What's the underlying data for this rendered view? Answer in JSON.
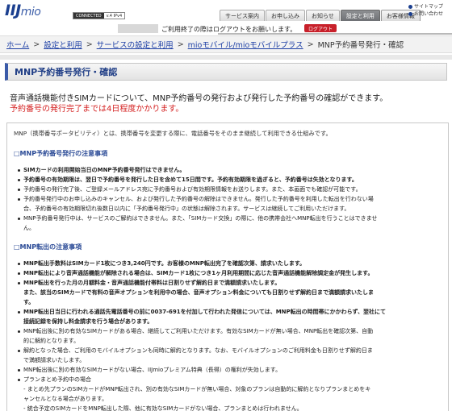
{
  "header": {
    "logo_main": "IIJ",
    "logo_sub": "mio",
    "conn_a": "CONNECTED",
    "conn_b": "v.4 IPv4",
    "tabs": [
      "サービス案内",
      "お申し込み",
      "お知らせ",
      "設定と利用",
      "お客様情報"
    ],
    "util": [
      "サイトマップ",
      "お問い合わせ"
    ]
  },
  "notice": {
    "text": "ご利用終了の際はログアウトをお願いします。",
    "logout": "ログアウト"
  },
  "breadcrumb": {
    "items": [
      "ホーム",
      "設定と利用",
      "サービスの設定と利用",
      "mioモバイル/mioモバイルプラス"
    ],
    "current": "MNP予約番号発行・確認"
  },
  "page": {
    "title": "MNP予約番号発行・確認",
    "lead1": "音声通話機能付きSIMカードについて、MNP予約番号の発行および発行した予約番号の確認ができます。",
    "lead2": "予約番号の発行完了までは4日程度かかります。"
  },
  "content": {
    "intro": "MNP（携帯番号ポータビリティ）とは、携帯番号を変更する際に、電話番号をそのまま継続して利用できる仕組みです。",
    "sec1": "□MNP予約番号発行の注意事項",
    "list1": [
      "SIMカードの利用開始当日のMNP予約番号発行はできません。",
      "予約番号の有効期限は、翌日で予約番号を発行した日を含めて15日間です。予約有効期限を過ぎると、予約番号は失効となります。",
      "予約番号の発行完了後、ご登録メールアドレス宛に予約番号および有効期限情報をお送りします。また、本画面でも確認が可能です。",
      "予約番号発行中のお申し込みのキャンセル、および発行した予約番号の解除はできません。発行した予約番号を利用した転出を行わない場",
      "合、予約番号の有効期限切れ後数日以内に「予約番号発行中」の状態は解除されます。サービスは継続してご利用いただけます。",
      "MNP予約番号発行中は、サービスのご解約はできません。また、「SIMカード交換」の際に、他の携帯会社へMNP転出を行うことはできませ",
      "ん。"
    ],
    "sec2": "□MNP転出の注意事項",
    "list2": [
      "MNP転出手数料はSIMカード1枚につき3,240円です。お客様のMNP転出完了を確認次第、請求いたします。",
      "MNP転出により音声通話機能が解除される場合は、SIMカード1枚につき1ヶ月利用期間に応じた音声通話機能解除調定金が発生します。",
      "MNP転出を行った月の月額料金・音声通話機能付帯料は日割りせず解約日まで満額請求いたします。",
      "また、該当のSIMカードで有料の音声オプションを利用中の場合、音声オプション料金についても日割りせず解約日まで満額請求いたしま",
      "す。",
      "MNP転出日当日に行われる通話先電話番号の前に0037-691を付加して行われた発信については、MNP転出の時間帯にかかわらず、翌社にて",
      "接続記録を保持し料金請求を行う場合があります。",
      "MNP転出後に別の有効なSIMカードがある場合、継続してご利用いただけます。有効なSIMカードが無い場合、MNP転出を確認次第、自動",
      "的に解約となります。",
      "解約となった場合、ご利用のモバイルオプションも同時に解約となります。なお、モバイルオプションのご利用料金も日割りせず解約日ま",
      "で満額請求いたします。",
      "MNP転出後に別の有効なSIMカードがない場合、IIJmioプレミアム特典（長得）の権利が失効します。",
      "プランまとめ予約中の場合",
      "- まとめ先プランのSIMカードがMNP転出され、別の有効なSIMカードが無い場合、対象のプランは自動的に解約となりプランまとめをキ",
      "ャンセルとなる場合があります。",
      "- 統合予定のSIMカードをMNP転出した際、他に有効なSIMカードがない場合、プランまとめは行われません。"
    ]
  }
}
